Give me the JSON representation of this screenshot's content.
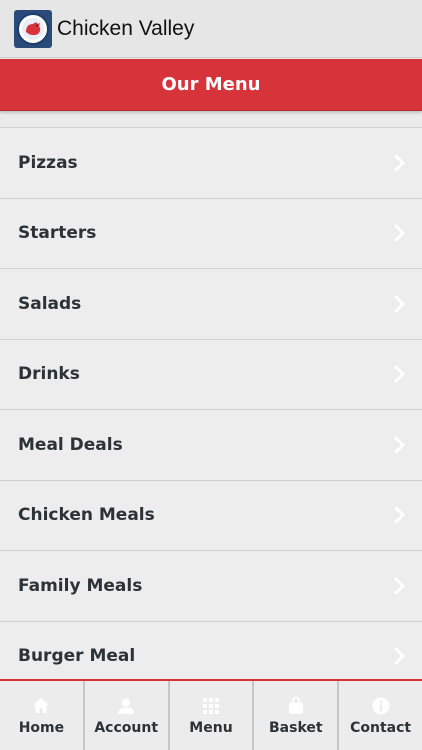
{
  "app": {
    "title": "Chicken Valley",
    "logo_icon": "chicken-logo-icon"
  },
  "header": {
    "title": "Our Menu"
  },
  "colors": {
    "accent": "#d6333b",
    "list_bg": "#ededed",
    "text": "#2c3338"
  },
  "menu": {
    "items": [
      {
        "label": "Pizzas"
      },
      {
        "label": "Starters"
      },
      {
        "label": "Salads"
      },
      {
        "label": "Drinks"
      },
      {
        "label": "Meal Deals"
      },
      {
        "label": "Chicken Meals"
      },
      {
        "label": "Family Meals"
      },
      {
        "label": "Burger Meal"
      }
    ]
  },
  "tabs": [
    {
      "label": "Home",
      "icon": "home-icon"
    },
    {
      "label": "Account",
      "icon": "user-icon"
    },
    {
      "label": "Menu",
      "icon": "grid-icon"
    },
    {
      "label": "Basket",
      "icon": "bag-icon"
    },
    {
      "label": "Contact",
      "icon": "info-icon"
    }
  ]
}
